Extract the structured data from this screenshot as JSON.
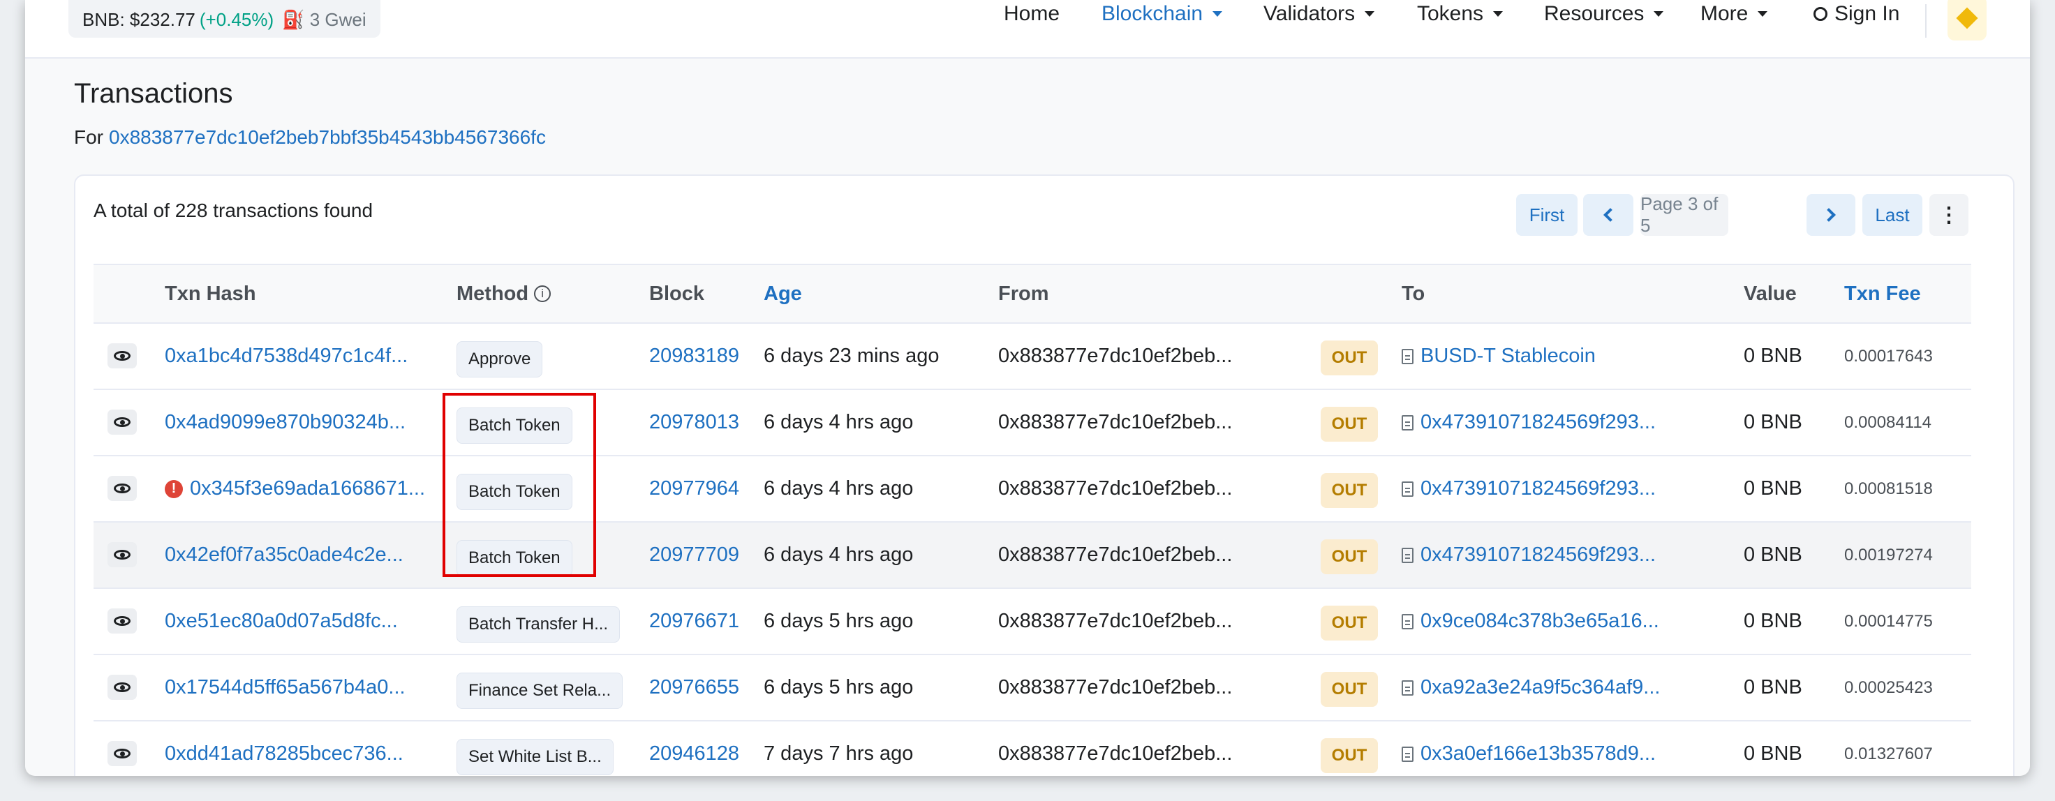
{
  "header": {
    "price_text": "BNB: $232.77",
    "price_change": "(+0.45%)",
    "gas_text": "⛽ 3 Gwei",
    "nav": [
      {
        "label": "Home"
      },
      {
        "label": "Blockchain"
      },
      {
        "label": "Validators"
      },
      {
        "label": "Tokens"
      },
      {
        "label": "Resources"
      },
      {
        "label": "More"
      }
    ],
    "sign_in": "Sign In"
  },
  "page": {
    "title": "Transactions",
    "for_label": "For",
    "address": "0x883877e7dc10ef2beb7bbf35b4543bb4567366fc"
  },
  "summary": {
    "total_text": "A total of 228 transactions found"
  },
  "pagination": {
    "first": "First",
    "page_info": "Page 3 of 5",
    "last": "Last",
    "more": "⋮"
  },
  "table": {
    "headers": {
      "txn_hash": "Txn Hash",
      "method": "Method",
      "block": "Block",
      "age": "Age",
      "from": "From",
      "to": "To",
      "value": "Value",
      "txn_fee": "Txn Fee"
    },
    "rows": [
      {
        "hash": "0xa1bc4d7538d497c1c4f...",
        "method": "Approve",
        "block": "20983189",
        "age": "6 days 23 mins ago",
        "from": "0x883877e7dc10ef2beb...",
        "direction": "OUT",
        "to": "BUSD-T Stablecoin",
        "value": "0 BNB",
        "fee": "0.00017643"
      },
      {
        "hash": "0x4ad9099e870b90324b...",
        "method": "Batch Token",
        "block": "20978013",
        "age": "6 days 4 hrs ago",
        "from": "0x883877e7dc10ef2beb...",
        "direction": "OUT",
        "to": "0x47391071824569f293...",
        "value": "0 BNB",
        "fee": "0.00084114"
      },
      {
        "hash": "0x345f3e69ada1668671...",
        "method": "Batch Token",
        "block": "20977964",
        "age": "6 days 4 hrs ago",
        "from": "0x883877e7dc10ef2beb...",
        "direction": "OUT",
        "to": "0x47391071824569f293...",
        "value": "0 BNB",
        "fee": "0.00081518"
      },
      {
        "hash": "0x42ef0f7a35c0ade4c2e...",
        "method": "Batch Token",
        "block": "20977709",
        "age": "6 days 4 hrs ago",
        "from": "0x883877e7dc10ef2beb...",
        "direction": "OUT",
        "to": "0x47391071824569f293...",
        "value": "0 BNB",
        "fee": "0.00197274"
      },
      {
        "hash": "0xe51ec80a0d07a5d8fc...",
        "method": "Batch Transfer H...",
        "block": "20976671",
        "age": "6 days 5 hrs ago",
        "from": "0x883877e7dc10ef2beb...",
        "direction": "OUT",
        "to": "0x9ce084c378b3e65a16...",
        "value": "0 BNB",
        "fee": "0.00014775"
      },
      {
        "hash": "0x17544d5ff65a567b4a0...",
        "method": "Finance Set Rela...",
        "block": "20976655",
        "age": "6 days 5 hrs ago",
        "from": "0x883877e7dc10ef2beb...",
        "direction": "OUT",
        "to": "0xa92a3e24a9f5c364af9...",
        "value": "0 BNB",
        "fee": "0.00025423"
      },
      {
        "hash": "0xdd41ad78285bcec736...",
        "method": "Set White List B...",
        "block": "20946128",
        "age": "7 days 7 hrs ago",
        "from": "0x883877e7dc10ef2beb...",
        "direction": "OUT",
        "to": "0x3a0ef166e13b3578d9...",
        "value": "0 BNB",
        "fee": "0.01327607"
      }
    ]
  },
  "icons": {
    "row_preview": "eye-icon",
    "error": "error-icon",
    "contract": "document-icon",
    "info": "info-icon"
  },
  "colors": {
    "link": "#1e70c1",
    "out_badge_bg": "#fbeccf",
    "out_badge_text": "#b47d00",
    "error": "#de4437",
    "annotation_box": "#e00000"
  }
}
